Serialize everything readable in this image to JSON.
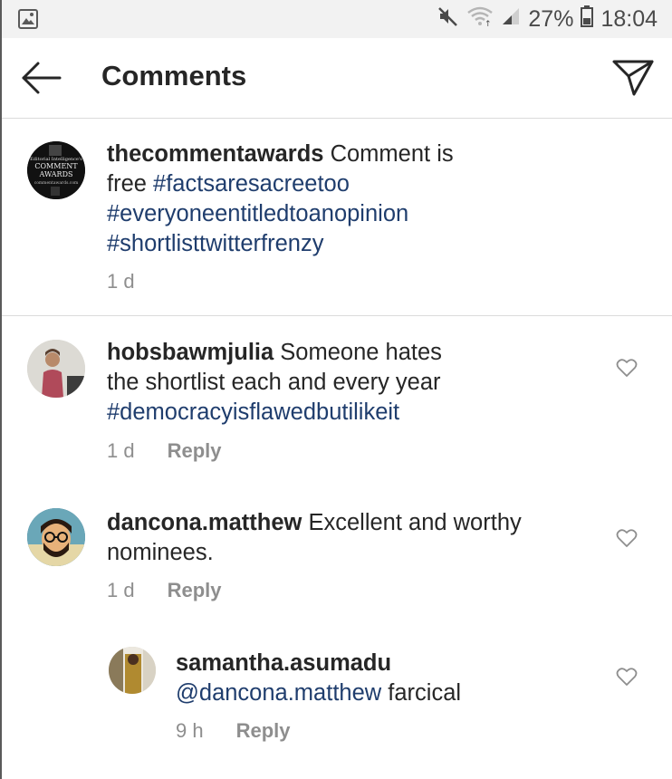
{
  "status_bar": {
    "battery_percent": "27%",
    "time": "18:04"
  },
  "header": {
    "title": "Comments"
  },
  "caption": {
    "username": "thecommentawards",
    "text": " Comment is free ",
    "hashtags": [
      "#factsaresacreetoo",
      "#everyoneentitledtoanopinion",
      "#shortlisttwitterfrenzy"
    ],
    "time": "1 d",
    "avatar_text": {
      "line1": "Editorial Intelligence's",
      "line2": "COMMENT",
      "line3": "AWARDS",
      "line4": "commentawards.com"
    }
  },
  "comments": [
    {
      "username": "hobsbawmjulia",
      "line1": " Someone hates",
      "line2": "the shortlist each and every year",
      "hashtag": "#democracyisflawedbutilikeit",
      "time": "1 d",
      "reply_label": "Reply"
    },
    {
      "username": "dancona.matthew",
      "line1": " Excellent and worthy",
      "line2": "nominees.",
      "time": "1 d",
      "reply_label": "Reply"
    },
    {
      "username": "samantha.asumadu",
      "mention": "@dancona.matthew",
      "text": " farcical",
      "time": "9 h",
      "reply_label": "Reply"
    }
  ]
}
